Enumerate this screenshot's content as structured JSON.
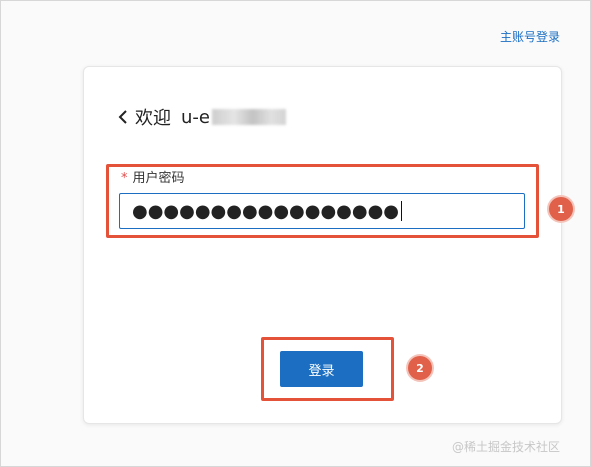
{
  "header": {
    "master_login_link": "主账号登录"
  },
  "card": {
    "welcome": "欢迎",
    "username_prefix": "u-e",
    "password_field": {
      "required_mark": "*",
      "label": "用户密码",
      "value": "●●●●●●●●●●●●●●●●●"
    },
    "login_button": "登录"
  },
  "annotations": {
    "step1": "1",
    "step2": "2"
  },
  "watermark": "@稀土掘金技术社区",
  "colors": {
    "accent": "#1b6ec2",
    "highlight": "#e5523a",
    "badge": "#e0604a"
  }
}
